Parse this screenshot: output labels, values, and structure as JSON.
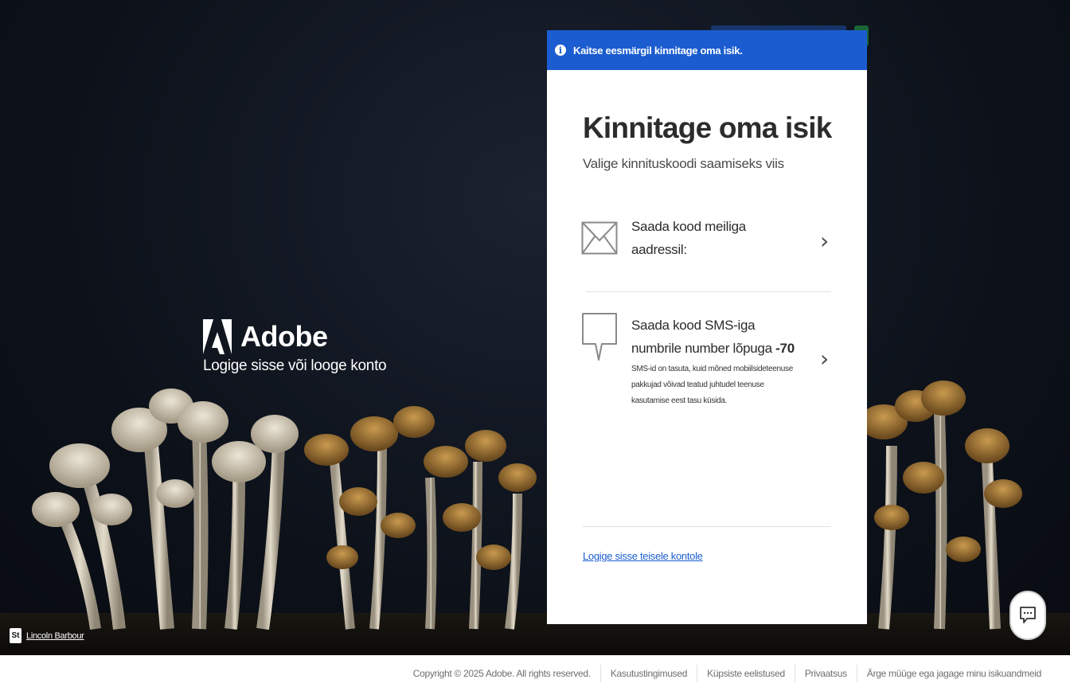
{
  "brand": {
    "name": "Adobe",
    "tagline": "Logige sisse või looge konto"
  },
  "photo_credit": {
    "badge": "St",
    "name": "Lincoln Barbour"
  },
  "dialog": {
    "banner": "Kaitse eesmärgil kinnitage oma isik.",
    "title": "Kinnitage oma isik",
    "subtitle": "Valige kinnituskoodi saamiseks viis",
    "email_option": {
      "label": "Saada kood meiliga aadressil:"
    },
    "sms_option": {
      "label_prefix": "Saada kood SMS-iga numbrile number lõpuga",
      "digits": "-70",
      "note": "SMS-id on tasuta, kuid mõned mobiilsideteenuse pakkujad võivad teatud juhtudel teenuse kasutamise eest tasu küsida."
    },
    "alt_account_link": "Logige sisse teisele kontole"
  },
  "footer": {
    "copyright": "Copyright © 2025 Adobe. All rights reserved.",
    "links": [
      "Kasutustingimused",
      "Küpsiste eelistused",
      "Privaatsus",
      "Ärge müüge ega jagage minu isikuandmeid"
    ]
  },
  "colors": {
    "accent": "#1b5dd0",
    "hero_bg": "#0e131c"
  }
}
